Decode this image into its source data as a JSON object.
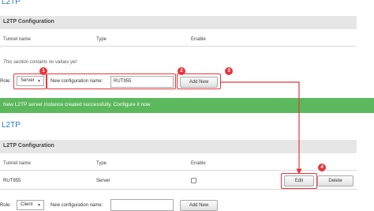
{
  "page_title": "L2TP",
  "section_title": "L2TP Configuration",
  "columns": {
    "tunnel_name": "Tunnel name",
    "type": "Type",
    "enable": "Enable"
  },
  "before": {
    "empty_message": "This section contains no values yet",
    "role_label": "Role:",
    "role_value": "Server",
    "new_config_label": "New configuration name:",
    "new_config_value": "RUT955",
    "add_button": "Add New"
  },
  "success_message": "New L2TP server instance created successfully. Configure it now",
  "after": {
    "heading": "L2TP",
    "section_title": "L2TP Configuration",
    "row": {
      "tunnel_name": "RUT955",
      "type": "Server",
      "enabled": false,
      "edit_button": "Edit",
      "delete_button": "Delete"
    },
    "role_label": "Role:",
    "role_value": "Client",
    "new_config_label": "New configuration name:",
    "new_config_value": "",
    "add_button": "Add New"
  },
  "steps": [
    "1",
    "2",
    "3",
    "4"
  ],
  "colors": {
    "accent": "#2b7ab8",
    "success": "#5cb85c",
    "callout": "#e8353b",
    "section_bg": "#e6e6e6"
  },
  "icons": {
    "select_caret": "▼"
  }
}
